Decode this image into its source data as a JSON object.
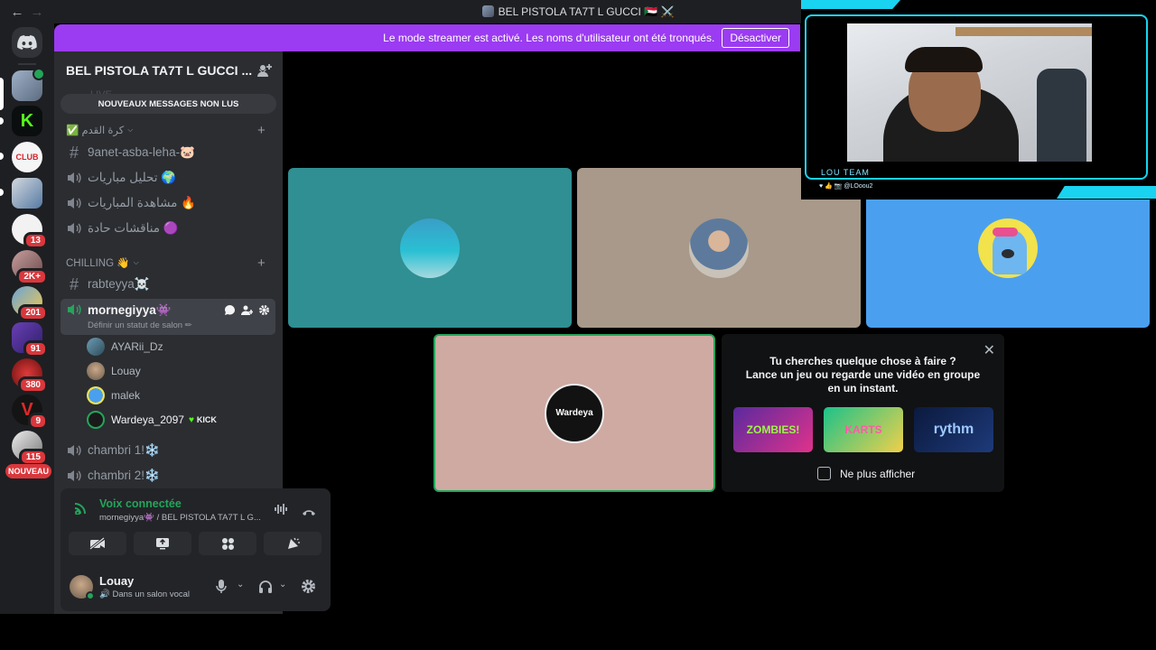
{
  "window": {
    "title": "BEL PISTOLA TA7T L GUCCI 🇸🇩 ⚔️",
    "back": "←",
    "forward": "→"
  },
  "banner": {
    "text": "Le mode streamer est activé. Les noms d'utilisateur ont été tronqués.",
    "button": "Désactiver"
  },
  "rail": {
    "badges": [
      "13",
      "2K+",
      "201",
      "91",
      "380",
      "9",
      "115"
    ],
    "new_label": "NOUVEAU"
  },
  "guild": {
    "name": "BEL PISTOLA TA7T L GUCCI ...",
    "unread": "NOUVEAUX MESSAGES NON LUS"
  },
  "categories": [
    {
      "label": "✅ كرة القدم"
    },
    {
      "label": "CHILLING 👋"
    }
  ],
  "channels": {
    "c1": "9anet-asba-leha-🐷",
    "c2": "تحليل مباريات 🌍",
    "c3": "مشاهدة المباريات 🔥",
    "c4": "مناقشات حادة 🟣",
    "c5": "rabteyya☠️",
    "active": "mornegiyya👾",
    "active_sub": "Définir un statut de salon ✏",
    "c7": "chambri 1!❄️",
    "c8": "chambri 2!❄️"
  },
  "voice_users": [
    {
      "name": "AYARii_Dz"
    },
    {
      "name": "Louay"
    },
    {
      "name": "malek"
    },
    {
      "name": "Wardeya_2097",
      "tag": "KICK"
    }
  ],
  "voice_panel": {
    "status": "Voix connectée",
    "location": "mornegiyya👾 / BEL PISTOLA TA7T L G..."
  },
  "user_panel": {
    "name": "Louay",
    "status": "🔊 Dans un salon vocal"
  },
  "activity": {
    "line1": "Tu cherches quelque chose à faire ?",
    "line2": "Lance un jeu ou regarde une vidéo en groupe en un instant.",
    "games": [
      "ZOMBIES!",
      "KARTS",
      "rythm"
    ],
    "checkbox": "Ne plus afficher"
  },
  "tiles": {
    "wardeya_label": "Wardeya"
  },
  "cam": {
    "label": "LOU TEAM",
    "social": "♥ 👍 📷 @LOoou2"
  },
  "colors": {
    "banner": "#9b3bf2",
    "voice_green": "#23a55a",
    "tile1": "#2f8f92",
    "tile2": "#a8998a",
    "tile3": "#4aa0ef",
    "tile4": "#cfaaa2",
    "cam_accent": "#19d3f0"
  }
}
